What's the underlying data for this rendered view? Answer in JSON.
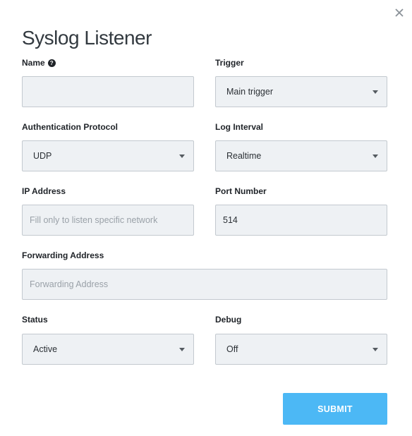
{
  "dialog": {
    "title": "Syslog Listener",
    "close_icon": "close-icon"
  },
  "fields": {
    "name": {
      "label": "Name",
      "value": "",
      "placeholder": "",
      "help_icon": "question-circle-icon"
    },
    "trigger": {
      "label": "Trigger",
      "value": "Main trigger"
    },
    "auth_protocol": {
      "label": "Authentication Protocol",
      "value": "UDP"
    },
    "log_interval": {
      "label": "Log Interval",
      "value": "Realtime"
    },
    "ip_address": {
      "label": "IP Address",
      "value": "",
      "placeholder": "Fill only to listen specific network"
    },
    "port_number": {
      "label": "Port Number",
      "value": "514"
    },
    "forwarding_address": {
      "label": "Forwarding Address",
      "value": "",
      "placeholder": "Forwarding Address"
    },
    "status": {
      "label": "Status",
      "value": "Active"
    },
    "debug": {
      "label": "Debug",
      "value": "Off"
    }
  },
  "actions": {
    "submit_label": "SUBMIT"
  },
  "colors": {
    "submit_bg": "#4cb8f5",
    "field_bg": "#eef1f4",
    "field_border": "#c3c9cf"
  }
}
